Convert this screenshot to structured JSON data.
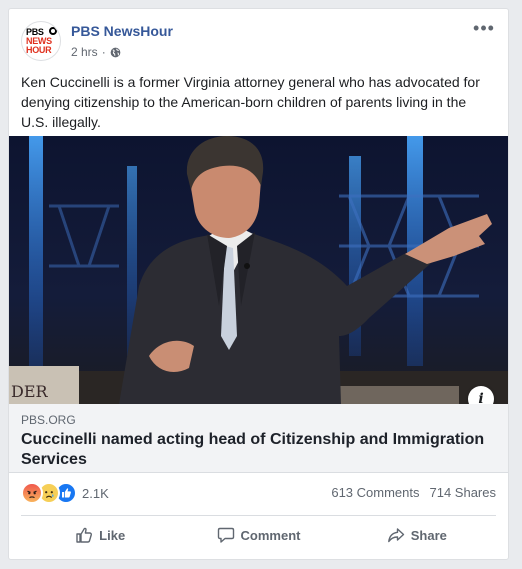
{
  "post": {
    "page_name": "PBS NewsHour",
    "avatar_lines": [
      "PBS",
      "NEWS",
      "HOUR"
    ],
    "time": "2 hrs",
    "separator": "·",
    "text": "Ken Cuccinelli is a former Virginia attorney general who has advocated for denying citizenship to the American-born children of parents living in the U.S. illegally.",
    "more_label": "•••"
  },
  "link": {
    "domain": "PBS.ORG",
    "headline": "Cuccinelli named acting head of Citizenship and Immigration Services",
    "info_label": "i",
    "image_text": "DER"
  },
  "stats": {
    "reactions": [
      "angry",
      "sad",
      "like"
    ],
    "reaction_count": "2.1K",
    "comments": "613 Comments",
    "shares": "714 Shares"
  },
  "actions": {
    "like": "Like",
    "comment": "Comment",
    "share": "Share"
  },
  "colors": {
    "brand_link": "#365899",
    "like_blue": "#1877f2",
    "muted": "#606770",
    "pbs_red": "#e0301e"
  }
}
